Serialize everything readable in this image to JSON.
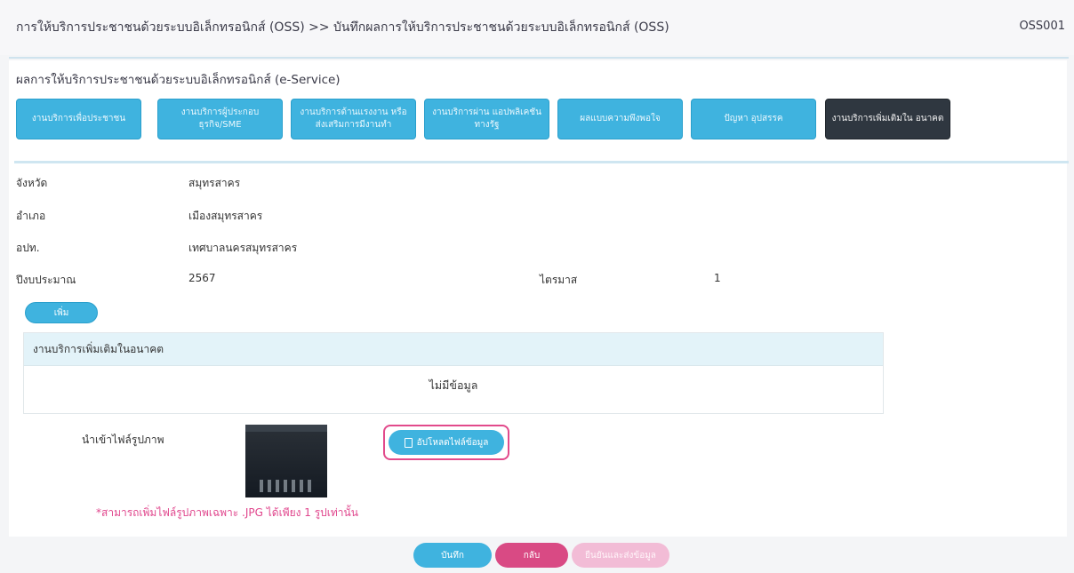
{
  "header": {
    "breadcrumb": "การให้บริการประชาชนด้วยระบบอิเล็กทรอนิกส์ (OSS) >> บันทึกผลการให้บริการประชาชนด้วยระบบอิเล็กทรอนิกส์ (OSS)",
    "page_code": "OSS001"
  },
  "section": {
    "title": "ผลการให้บริการประชาชนด้วยระบบอิเล็กทรอนิกส์ (e-Service)"
  },
  "tabs": [
    {
      "label": "งานบริการเพื่อประชาชน",
      "active": false
    },
    {
      "label": "งานบริการผู้ประกอบ ธุรกิจ/SME",
      "active": false
    },
    {
      "label": "งานบริการด้านแรงงาน หรือส่งเสริมการมีงานทำ",
      "active": false
    },
    {
      "label": "งานบริการผ่าน แอปพลิเคชันทางรัฐ",
      "active": false
    },
    {
      "label": "ผลแบบความพึงพอใจ",
      "active": false
    },
    {
      "label": "ปัญหา อุปสรรค",
      "active": false
    },
    {
      "label": "งานบริการเพิ่มเติมใน อนาคต",
      "active": true
    }
  ],
  "info": {
    "province_label": "จังหวัด",
    "province_value": "สมุทรสาคร",
    "district_label": "อำเภอ",
    "district_value": "เมืองสมุทรสาคร",
    "lao_label": "อปท.",
    "lao_value": "เทศบาลนครสมุทรสาคร",
    "fiscal_year_label": "ปีงบประมาณ",
    "fiscal_year_value": "2567",
    "quarter_label": "ไตรมาส",
    "quarter_value": "1"
  },
  "add_button_label": "เพิ่ม",
  "table": {
    "header": "งานบริการเพิ่มเติมในอนาคต",
    "empty_text": "ไม่มีข้อมูล"
  },
  "upload": {
    "label": "นำเข้าไฟล์รูปภาพ",
    "button_label": "อัปโหลดไฟล์ข้อมูล",
    "note": "*สามารถเพิ่มไฟล์รูปภาพเฉพาะ .JPG ได้เพียง 1 รูปเท่านั้น",
    "highlight_color": "#e24a8b"
  },
  "footer": {
    "save_label": "บันทึก",
    "back_label": "กลับ",
    "confirm_label": "ยืนยันและส่งข้อมูล"
  },
  "colors": {
    "primary": "#3fb3df",
    "active_tab": "#2f3740",
    "danger": "#d94a84",
    "disabled_pink": "#f2bcd6"
  }
}
